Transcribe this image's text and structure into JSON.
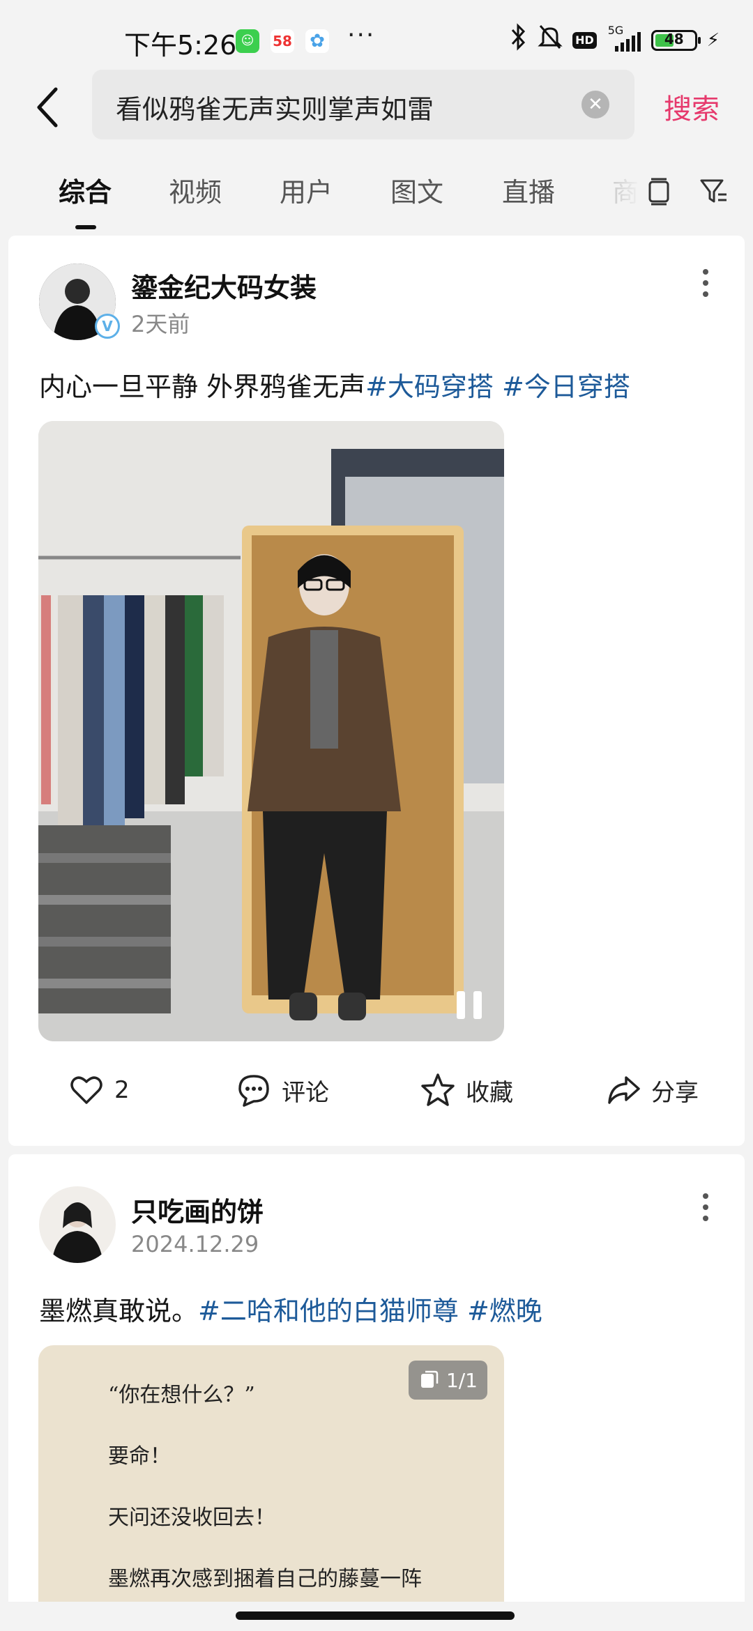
{
  "status_bar": {
    "time": "下午5:26",
    "network": "5G",
    "battery": "48",
    "battery_level": 0.48,
    "hd_badge": "HD",
    "notification_app_58": "58",
    "more_dots": "···"
  },
  "search": {
    "query": "看似鸦雀无声实则掌声如雷",
    "submit_label": "搜索"
  },
  "tabs": [
    {
      "label": "综合",
      "active": true
    },
    {
      "label": "视频"
    },
    {
      "label": "用户"
    },
    {
      "label": "图文"
    },
    {
      "label": "直播"
    },
    {
      "label": "商"
    }
  ],
  "posts": [
    {
      "author": "鎏金纪大码女装",
      "time": "2天前",
      "verified": true,
      "caption_text": "内心一旦平静 外界鸦雀无声",
      "hashtags": [
        "#大码穿搭",
        "#今日穿搭"
      ],
      "media_type": "video",
      "actions": {
        "like_count": "2",
        "comment_label": "评论",
        "favorite_label": "收藏",
        "share_label": "分享"
      }
    },
    {
      "author": "只吃画的饼",
      "time": "2024.12.29",
      "verified": false,
      "caption_text": "墨燃真敢说。",
      "hashtags": [
        "#二哈和他的白猫师尊",
        "#燃晚"
      ],
      "media_type": "text-image",
      "page_badge": "1/1",
      "image_lines": [
        "“你在想什么？”",
        "要命！",
        "天问还没收回去！",
        "墨燃再次感到捆着自己的藤蔓一阵"
      ]
    }
  ],
  "colors": {
    "accent": "#e6396c",
    "hashtag": "#1d5a99",
    "background": "#f3f3f3"
  }
}
